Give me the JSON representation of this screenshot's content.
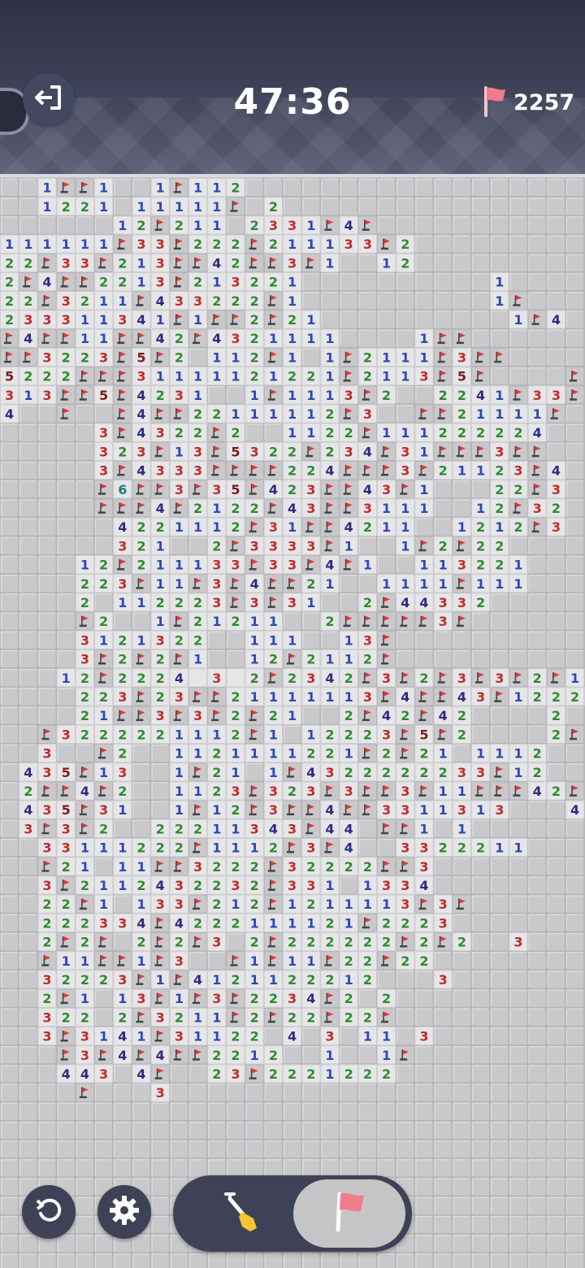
{
  "header": {
    "timer": "47:36",
    "flags_remaining": "2257",
    "exit_icon": "exit-icon",
    "flag_icon": "flag-icon"
  },
  "colors": {
    "background_header": "#3a3d52",
    "tile_closed": "#c9c9cb",
    "tile_open": "#e6e6e8",
    "n1": "#2f47b8",
    "n2": "#2f8a2f",
    "n3": "#c02b2b",
    "n4": "#2d2a80",
    "n5": "#7a1c1c",
    "n6": "#1b7f7f",
    "flag_red": "#d93b3b"
  },
  "controls": {
    "undo": "undo-icon",
    "settings": "gear-icon",
    "mode_dig": "shovel-icon",
    "mode_flag": "flag-icon",
    "selected_mode": "flag"
  },
  "board": {
    "cols": 31,
    "rows": 58,
    "rows_data": [
      "##1FF1##1F112##################",
      "##1221#11111F#2################",
      "######12F211#2331F4F###########",
      "111111F33F222F211133F2#########",
      "22F33F213FF42FF3F1##12#########",
      "2F4FF2213F213221##########1####",
      "22F3211F433222F1##########1F###",
      "233311341F1FF2F21##########1F4#",
      "F4FF11FF42F4321111####1FF######",
      "FF3223F5F2#112F1#1F2111F3FF####",
      "5222FFF31111121221F2113F5F####F",
      "313FF5F4231##1F1113F2##2241F33F",
      "4##F##F4FF22111112F3##FF21111F#",
      "#####3F4322F2##1122F111222224##",
      "#####323F13F5322F234F31FFF3FF##",
      "#####3F4333FFFF224FFF3F21123F4#",
      "#####F6FF3F35F423FF43F1###22F3#",
      "#####FFF4F2122F43FF3111##12F32#",
      "######4221112F31FF4211##1212F3##",
      "######321##2F3333F1##1F2F22####",
      "####12F211133F33F4F1##113221###",
      "####223F11F3F4FF21##1111F111###",
      "####2#112223F3F31##2F44332#####",
      "####F2##1F21211##2FFFFF3F#####",
      "####3121322##111##13F##########",
      "####3F2F2F1##12F2112F##########",
      "###12F2224 3 2F2342F3F2F3F3F2F1",
      "####223F23FF21111113F4FF43F12222",
      "####21FF3F3F2F21##2F42F42####2#",
      "##F3222221112F1#12223F5F2####2F",
      "##3##F2##1121111221F2F21#1112##",
      "#435F13##1F21#1F4322222233F12##",
      "#2FF4F2##1123F323F3FF3F11FFF42F",
      "#435F31##1F12F3FF4FF3311313###4",
      "#3F3F2##22211343F44#FF1#1######",
      "##33111222F1112F3F4##3322211###",
      "##F21#11FF3222F32222FF3########",
      "##3F2112432232F331#1334########",
      "##22F1#133F212F1211113F3F######",
      "##222334F4222111121F2223#######",
      "##2F2F#2F2F3#2F222222F2F2##3###",
      "##F11FF1F3##F1F11F22F22########",
      "##32223F1F4121122212###3#######",
      "##2F1#13F1F3F2234F2#2##########",
      "##322#2F3211F2F22F22F##########",
      "##3F3141F31122#4#3#11#3########",
      "###F3F4F4FF2212##1##1F#########",
      "###443#4F##23F2221222##########",
      "####F###3######################"
    ]
  }
}
